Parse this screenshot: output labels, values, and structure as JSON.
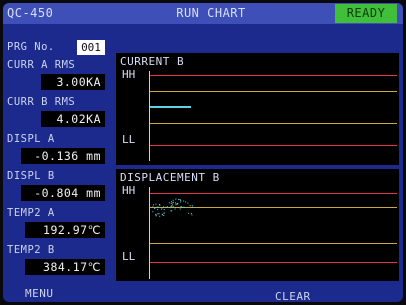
{
  "header": {
    "model": "QC-450",
    "title": "RUN CHART",
    "status": "READY"
  },
  "program": {
    "label": "PRG No.",
    "value": "001"
  },
  "readings": [
    {
      "label": "CURR A RMS",
      "value": "3.00KA"
    },
    {
      "label": "CURR B RMS",
      "value": "4.02KA"
    },
    {
      "label": "DISPL A",
      "value": "-0.136 mm"
    },
    {
      "label": "DISPL B",
      "value": "-0.804 mm"
    },
    {
      "label": "TEMP2 A",
      "value": "192.97℃"
    },
    {
      "label": "TEMP2 B",
      "value": "384.17℃"
    }
  ],
  "charts": [
    {
      "title": "CURRENT B",
      "upper_tag": "HH",
      "lower_tag": "LL"
    },
    {
      "title": "DISPLACEMENT B",
      "upper_tag": "HH",
      "lower_tag": "LL"
    }
  ],
  "footer": {
    "left_key": "MENU",
    "right_key": "CLEAR"
  },
  "colors": {
    "limit_high": "#e0384a",
    "limit_warn": "#c9a93a",
    "trace": "#5fd3e6",
    "ready": "#3fbf3a"
  }
}
